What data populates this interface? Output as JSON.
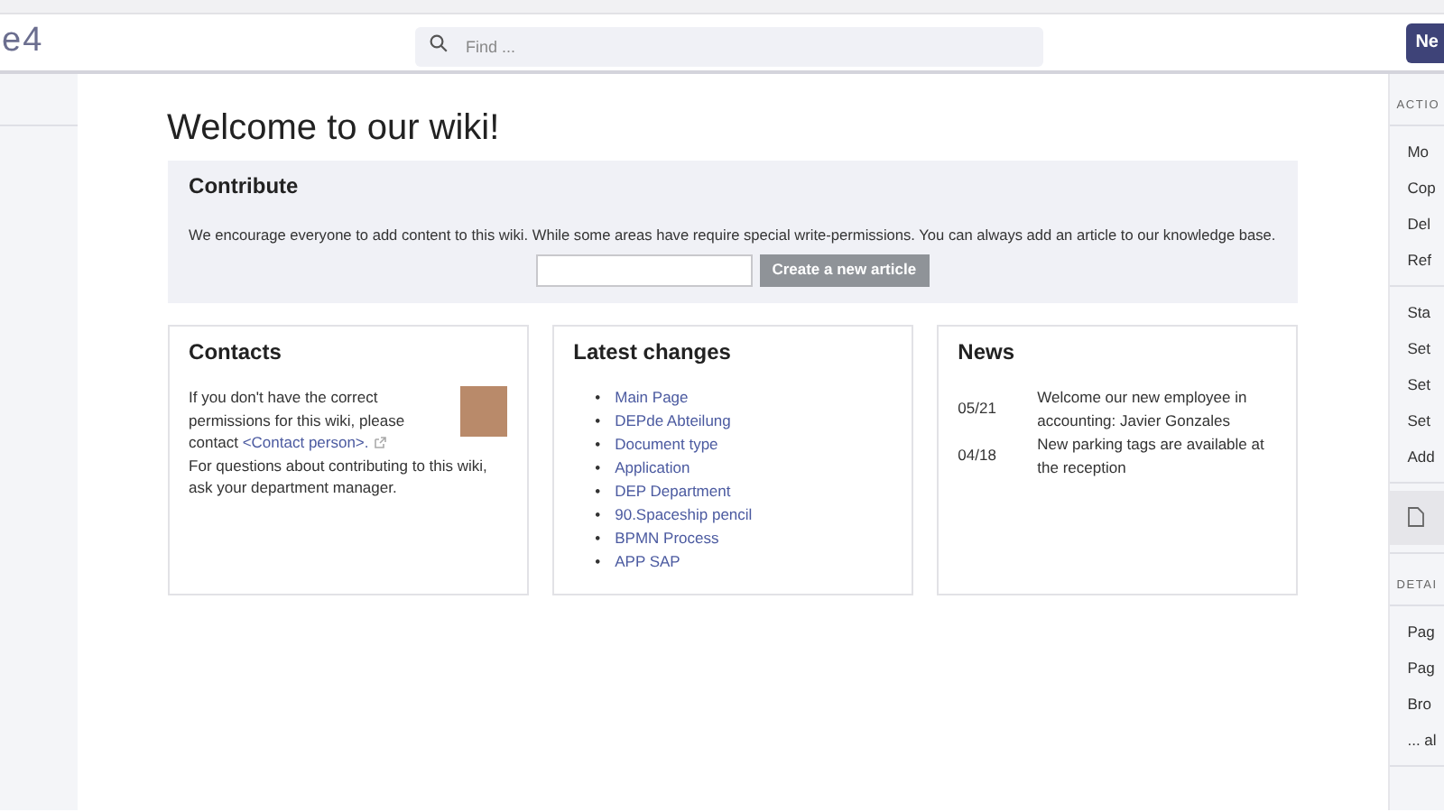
{
  "header": {
    "logo": "e4",
    "search": {
      "placeholder": "Find ..."
    },
    "new_button": "Ne"
  },
  "page_title": "Welcome to our wiki!",
  "contribute": {
    "title": "Contribute",
    "text": "We encourage everyone to add content to this wiki. While some areas have require special write-permissions. You can always add an article to our knowledge base.",
    "button": {
      "label": "Create a new article",
      "disabled": true
    }
  },
  "contacts": {
    "title": "Contacts",
    "intro": "If you don't have the correct permissions for this wiki, please contact ",
    "link": "<Contact person>.",
    "note": "For questions about contributing to this wiki, ask your department manager."
  },
  "latest_changes": {
    "title": "Latest changes",
    "items": [
      {
        "marker": "•",
        "label": "Main Page"
      },
      {
        "marker": "•",
        "label": "DEPde Abteilung"
      },
      {
        "marker": "•",
        "label": "Document type"
      },
      {
        "marker": "•",
        "label": "Application"
      },
      {
        "marker": "•",
        "label": "DEP Department"
      },
      {
        "marker": "•",
        "label": "90.Spaceship pencil"
      },
      {
        "marker": "•",
        "label": "BPMN Process"
      },
      {
        "marker": "•",
        "label": "APP SAP"
      }
    ]
  },
  "news": {
    "title": "News",
    "items": [
      {
        "date": "05/21",
        "text": "Welcome our new employee in accounting: Javier Gonzales"
      },
      {
        "date": "04/18",
        "text": "New parking tags are available at the reception"
      }
    ]
  },
  "right_sidebar": {
    "sections": [
      {
        "heading": "ACTIO",
        "groups": [
          [
            {
              "kind": "text",
              "label": "Mo",
              "selected": false
            },
            {
              "kind": "text",
              "label": "Cop",
              "selected": false
            },
            {
              "kind": "text",
              "label": "Del",
              "selected": false
            },
            {
              "kind": "text",
              "label": "Ref",
              "selected": false
            }
          ],
          [
            {
              "kind": "text",
              "label": "Sta",
              "selected": false
            },
            {
              "kind": "text",
              "label": "Set",
              "selected": false
            },
            {
              "kind": "text",
              "label": "Set",
              "selected": false
            },
            {
              "kind": "text",
              "label": "Set",
              "selected": false
            },
            {
              "kind": "text",
              "label": "Add",
              "selected": false
            }
          ],
          [
            {
              "kind": "icon",
              "selected": true
            }
          ]
        ]
      },
      {
        "heading": "DETAI",
        "groups": [
          [
            {
              "kind": "text",
              "label": "Pag",
              "selected": false
            },
            {
              "kind": "text",
              "label": "Pag",
              "selected": false
            },
            {
              "kind": "text",
              "label": "Bro",
              "selected": false
            },
            {
              "kind": "text",
              "label": "... al",
              "selected": false
            }
          ]
        ]
      }
    ]
  }
}
